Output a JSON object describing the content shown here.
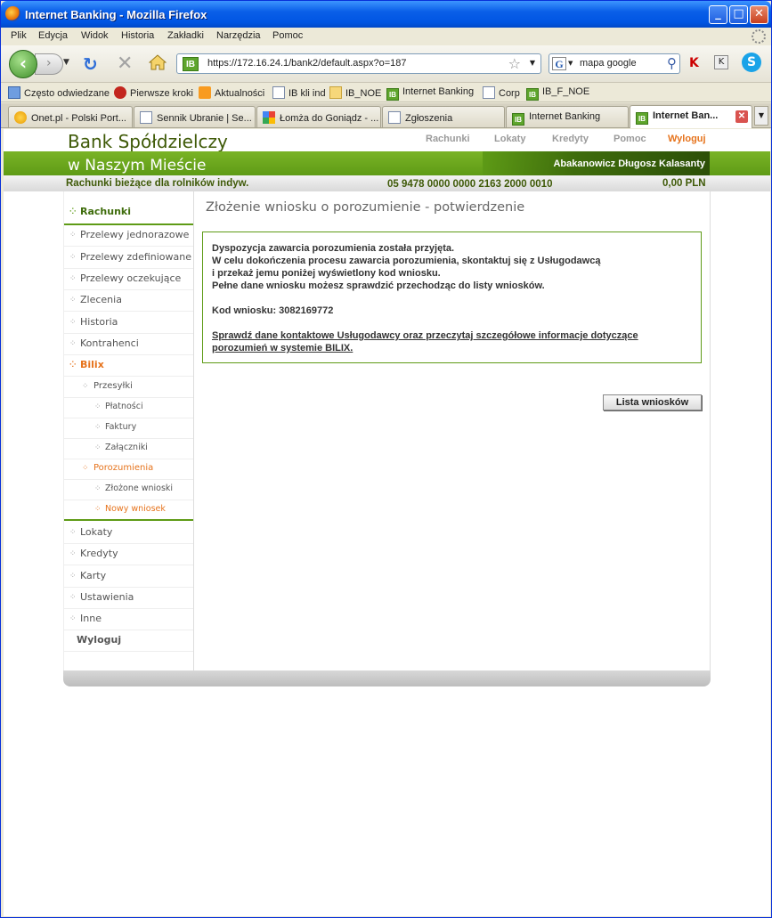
{
  "window": {
    "title": "Internet Banking - Mozilla Firefox",
    "menu": [
      "Plik",
      "Edycja",
      "Widok",
      "Historia",
      "Zakładki",
      "Narzędzia",
      "Pomoc"
    ]
  },
  "navbar": {
    "url": "https://172.16.24.1/bank2/default.aspx?o=187",
    "search_query": "mapa google"
  },
  "bookmarks": [
    {
      "label": "Często odwiedzane",
      "icon": "often-visited-icon"
    },
    {
      "label": "Pierwsze kroki",
      "icon": "first-steps-icon"
    },
    {
      "label": "Aktualności",
      "icon": "rss-icon"
    },
    {
      "label": "IB kli ind",
      "icon": "page-icon"
    },
    {
      "label": "IB_NOE",
      "icon": "folder-icon"
    },
    {
      "label": "Internet Banking",
      "icon": "ib-icon"
    },
    {
      "label": "Corp",
      "icon": "page-icon"
    },
    {
      "label": "IB_F_NOE",
      "icon": "ib-icon"
    }
  ],
  "tabs": [
    {
      "label": "Onet.pl - Polski Port...",
      "icon": "onet-icon"
    },
    {
      "label": "Sennik Ubranie | Se...",
      "icon": "page-icon"
    },
    {
      "label": "Łomża do Goniądz - ...",
      "icon": "google-icon"
    },
    {
      "label": "Zgłoszenia",
      "icon": "page-icon"
    },
    {
      "label": "Internet Banking",
      "icon": "ib-icon"
    },
    {
      "label": "Internet Ban...",
      "icon": "ib-icon",
      "active": true
    }
  ],
  "bank": {
    "name": "Bank Spółdzielczy",
    "subname": "w Naszym Mieście",
    "nav": [
      "Rachunki",
      "Lokaty",
      "Kredyty",
      "Pomoc",
      "Wyloguj"
    ],
    "user": "Abakanowicz Długosz Kalasanty",
    "account": {
      "name": "Rachunki bieżące dla rolników indyw.",
      "number": "05 9478 0000 0000 2163 2000 0010",
      "balance": "0,00 PLN"
    },
    "colors": {
      "green": "#5e9b16",
      "orange": "#e6731c",
      "dark_green": "#3f5a08"
    }
  },
  "sidebar": {
    "items": [
      {
        "label": "Rachunki"
      },
      {
        "label": "Przelewy jednorazowe"
      },
      {
        "label": "Przelewy zdefiniowane"
      },
      {
        "label": "Przelewy oczekujące"
      },
      {
        "label": "Zlecenia"
      },
      {
        "label": "Historia"
      },
      {
        "label": "Kontrahenci"
      },
      {
        "label": "Bilix"
      },
      {
        "label": "Przesyłki"
      },
      {
        "label": "Płatności"
      },
      {
        "label": "Faktury"
      },
      {
        "label": "Załączniki"
      },
      {
        "label": "Porozumienia"
      },
      {
        "label": "Złożone wnioski"
      },
      {
        "label": "Nowy wniosek"
      },
      {
        "label": "Lokaty"
      },
      {
        "label": "Kredyty"
      },
      {
        "label": "Karty"
      },
      {
        "label": "Ustawienia"
      },
      {
        "label": "Inne"
      },
      {
        "label": "Wyloguj"
      }
    ]
  },
  "main": {
    "title": "Złożenie wniosku o porozumienie - potwierdzenie",
    "message": {
      "line1": "Dyspozycja zawarcia porozumienia została przyjęta.",
      "line2": "W celu dokończenia procesu zawarcia porozumienia, skontaktuj się z Usługodawcą",
      "line3": "i przekaż jemu poniżej wyświetlony kod wniosku.",
      "line4": "Pełne dane wniosku możesz sprawdzić przechodząc do listy wniosków.",
      "code": "Kod wniosku: 3082169772",
      "link": "Sprawdź dane kontaktowe Usługodawcy oraz przeczytaj szczegółowe informacje dotyczące porozumień w systemie BILIX."
    },
    "list_button": "Lista wniosków"
  }
}
